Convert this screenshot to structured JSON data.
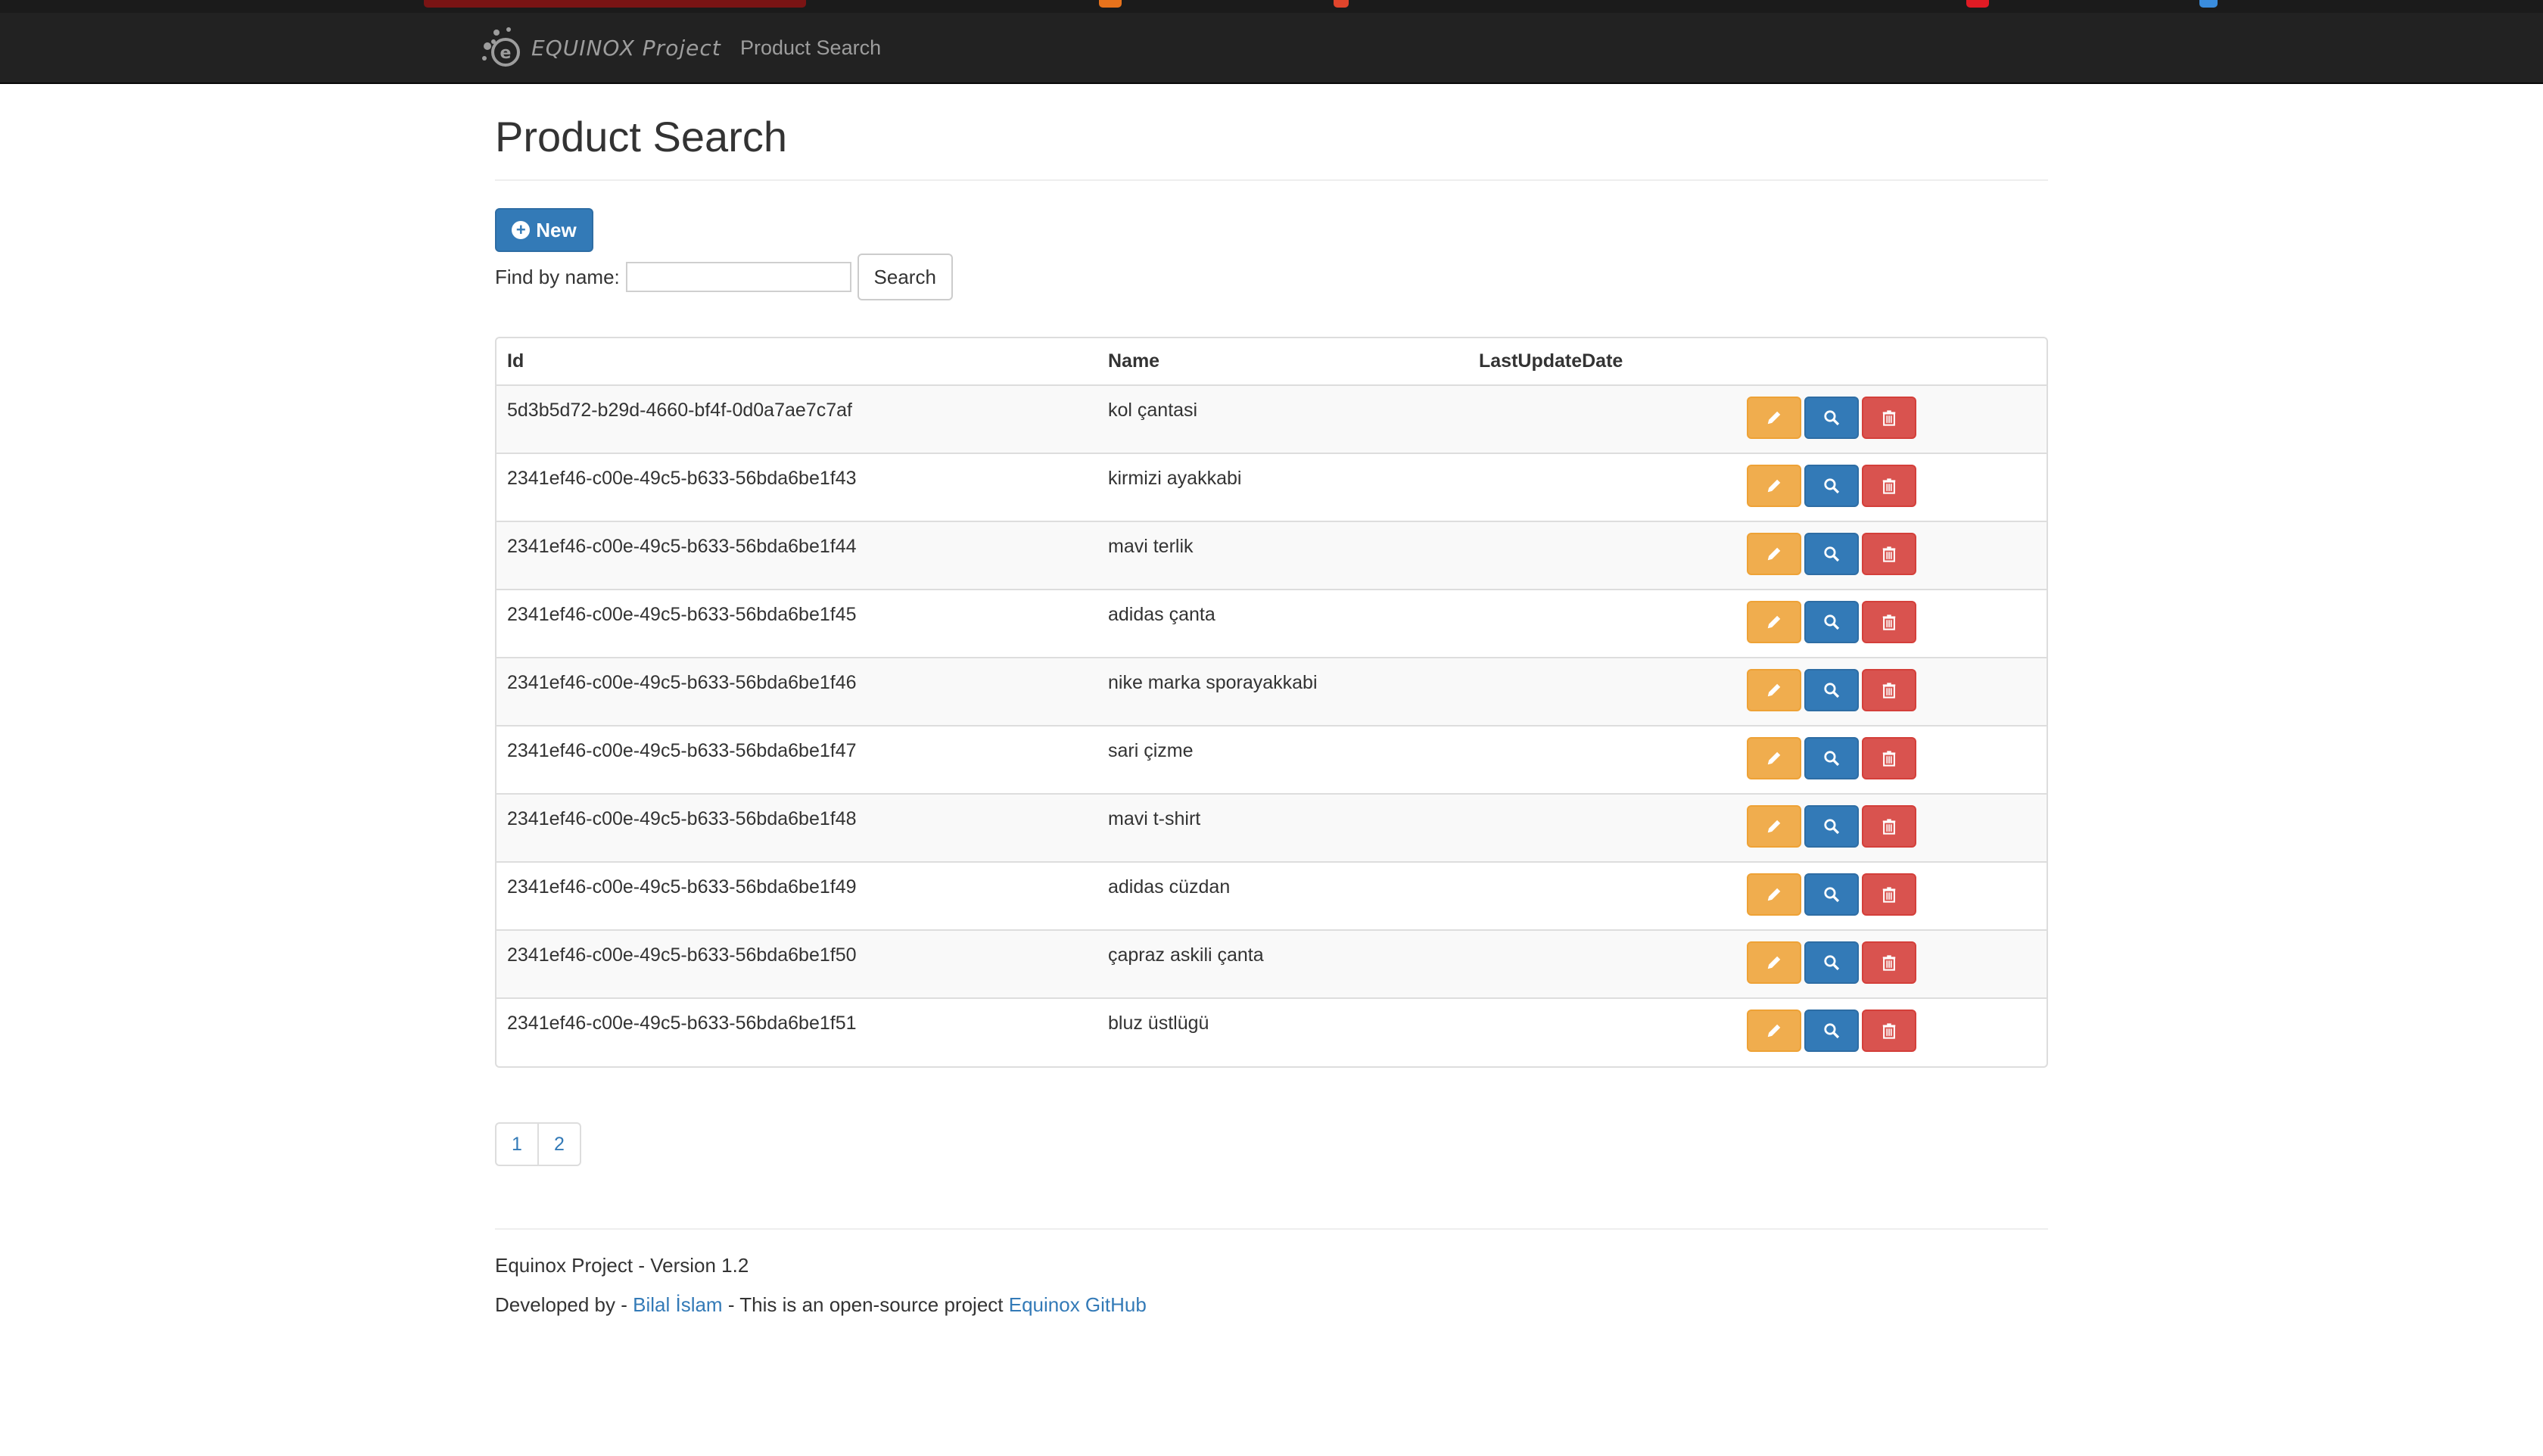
{
  "navbar": {
    "brand_text": "EQUINOX Project",
    "link": "Product Search"
  },
  "page": {
    "title": "Product Search",
    "new_button": "New",
    "find_label": "Find by name:",
    "find_value": "",
    "search_button": "Search"
  },
  "table": {
    "headers": [
      "Id",
      "Name",
      "LastUpdateDate"
    ],
    "rows": [
      {
        "id": "5d3b5d72-b29d-4660-bf4f-0d0a7ae7c7af",
        "name": "kol çantasi",
        "last_update": ""
      },
      {
        "id": "2341ef46-c00e-49c5-b633-56bda6be1f43",
        "name": "kirmizi ayakkabi",
        "last_update": ""
      },
      {
        "id": "2341ef46-c00e-49c5-b633-56bda6be1f44",
        "name": "mavi terlik",
        "last_update": ""
      },
      {
        "id": "2341ef46-c00e-49c5-b633-56bda6be1f45",
        "name": "adidas çanta",
        "last_update": ""
      },
      {
        "id": "2341ef46-c00e-49c5-b633-56bda6be1f46",
        "name": "nike marka sporayakkabi",
        "last_update": ""
      },
      {
        "id": "2341ef46-c00e-49c5-b633-56bda6be1f47",
        "name": "sari çizme",
        "last_update": ""
      },
      {
        "id": "2341ef46-c00e-49c5-b633-56bda6be1f48",
        "name": "mavi t-shirt",
        "last_update": ""
      },
      {
        "id": "2341ef46-c00e-49c5-b633-56bda6be1f49",
        "name": "adidas cüzdan",
        "last_update": ""
      },
      {
        "id": "2341ef46-c00e-49c5-b633-56bda6be1f50",
        "name": "çapraz askili çanta",
        "last_update": ""
      },
      {
        "id": "2341ef46-c00e-49c5-b633-56bda6be1f51",
        "name": "bluz üstlügü",
        "last_update": ""
      }
    ],
    "row_actions": [
      "pencil-icon",
      "search-icon",
      "trash-icon"
    ]
  },
  "pagination": {
    "pages": [
      "1",
      "2"
    ]
  },
  "footer": {
    "version": "Equinox Project - Version 1.2",
    "developed_by": "Developed by - ",
    "author_link": "Bilal İslam",
    "open_source_text": " - This is an open-source project ",
    "github_link": "Equinox GitHub"
  },
  "colors": {
    "navbar_bg": "#222222",
    "primary": "#337ab7",
    "warning": "#f0ad4e",
    "danger": "#d9534f",
    "nav_text": "#9d9d9d"
  }
}
